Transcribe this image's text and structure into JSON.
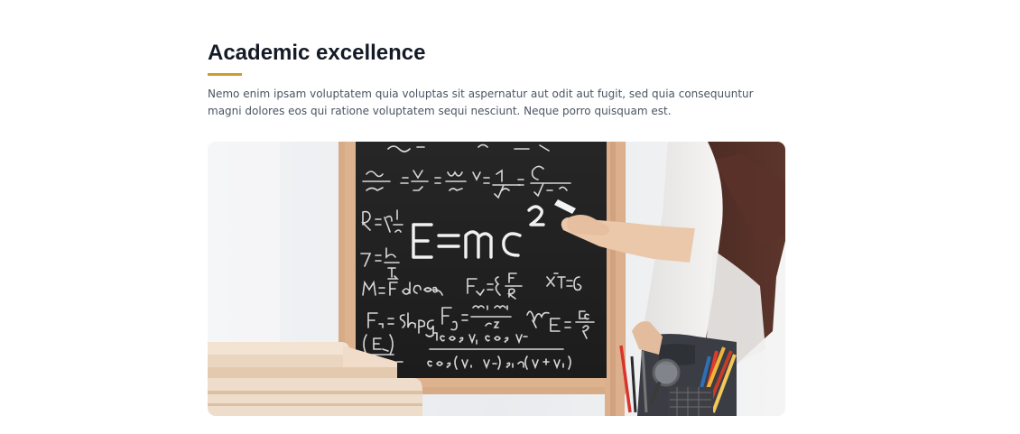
{
  "section": {
    "title": "Academic excellence",
    "description": "Nemo enim ipsam voluptatem quia voluptas sit aspernatur aut odit aut fugit, sed quia consequuntur magni dolores eos qui ratione voluptatem sequi nesciunt. Neque porro quisquam est."
  },
  "image": {
    "chalkboard": {
      "equation": "E=mc²",
      "formulas": [
        "sinα = V₁ = w₁ V= 1 = C",
        "R=ρ l/s",
        "F= l₀/T",
        "M= F⃗d cos α    F = ξ Fn/R    x²T = 6",
        "Fn = Shpg    Fg = m₁m₂/r²    E = Ec/q",
        "(E/r)   cos V₁ cos V₂",
        "cos(V₁ V₂) sin(V₁+V₂)"
      ]
    }
  },
  "colors": {
    "title": "#141a26",
    "accent": "#d09b2c",
    "body_text": "#4b5563",
    "chalkboard": "#222222",
    "board_frame": "#d7a985"
  }
}
